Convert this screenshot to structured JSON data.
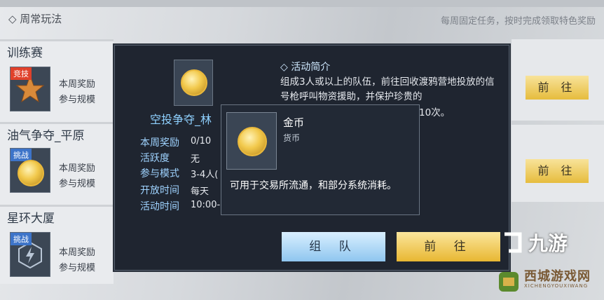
{
  "header": {
    "title": "◇ 周常玩法",
    "note": "每周固定任务，按时完成领取特色奖励"
  },
  "cards": [
    {
      "name": "训练赛",
      "tag": "竞技",
      "tag_color": "#e0412b",
      "reward_label": "本周奖励",
      "scale_label": "参与规模"
    },
    {
      "name": "油气争夺_平原",
      "tag": "挑战",
      "tag_color": "#3d74c9",
      "reward_label": "本周奖励",
      "scale_label": "参与规模"
    },
    {
      "name": "星环大厦",
      "tag": "挑战",
      "tag_color": "#3d74c9",
      "reward_label": "本周奖励",
      "scale_label": "参与规模"
    }
  ],
  "right_buttons": [
    "前 往",
    "前 往"
  ],
  "panel": {
    "title": "空投争夺_林",
    "info": [
      {
        "key": "本周奖励",
        "value": "0/10"
      },
      {
        "key": "活跃度",
        "value": "无"
      },
      {
        "key": "参与模式",
        "value": "3-4人("
      },
      {
        "key": "开放时间",
        "value": "每天"
      },
      {
        "key": "活动时间",
        "value": "10:00-"
      }
    ],
    "section_title": "◇ 活动简介",
    "description": "组成3人或以上的队伍，前往回收渡鸦营地投放的信号枪呼叫物资援助，并保护珍贵的",
    "description_tail": "10次。",
    "team_button": "组 队",
    "go_button": "前 往"
  },
  "tooltip": {
    "item_name": "金币",
    "item_type": "货币",
    "description": "可用于交易所流通，和部分系统消耗。"
  },
  "watermark": {
    "logo": "九游",
    "title": "西城游戏网",
    "subtitle": "XICHENGYOUXIWANG"
  }
}
